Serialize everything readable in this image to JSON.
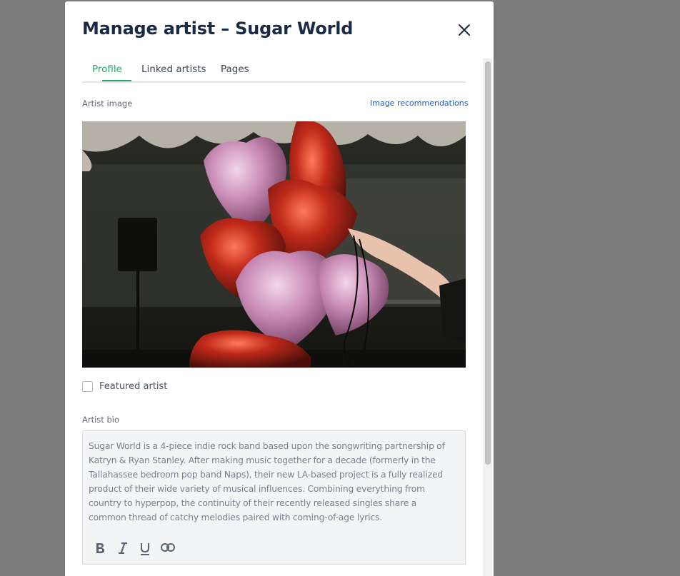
{
  "modal": {
    "title": "Manage artist – Sugar World",
    "close_icon": "close-icon"
  },
  "tabs": [
    {
      "label": "Profile",
      "active": true
    },
    {
      "label": "Linked artists",
      "active": false
    },
    {
      "label": "Pages",
      "active": false
    }
  ],
  "artist_image": {
    "label": "Artist image",
    "recommendations_link": "Image recommendations"
  },
  "featured": {
    "label": "Featured artist",
    "checked": false
  },
  "bio": {
    "label": "Artist bio",
    "text": "Sugar World is a 4-piece indie rock band based upon the songwriting partnership of Katryn & Ryan Stanley. After making music together for a decade (formerly in the Tallahassee bedroom pop band Naps), their new LA-based project is a fully realized product of their wide variety of musical influences. Combining everything from country to hyperpop, the continuity of their recently released singles share a common thread of catchy melodies paired with coming-of-age lyrics.",
    "toolbar": [
      "bold-icon",
      "italic-icon",
      "underline-icon",
      "link-icon"
    ]
  },
  "colors": {
    "accent": "#2fa36b",
    "title": "#1c2b45",
    "link": "#1f5bc2",
    "overlay": "#7b7b7b"
  }
}
